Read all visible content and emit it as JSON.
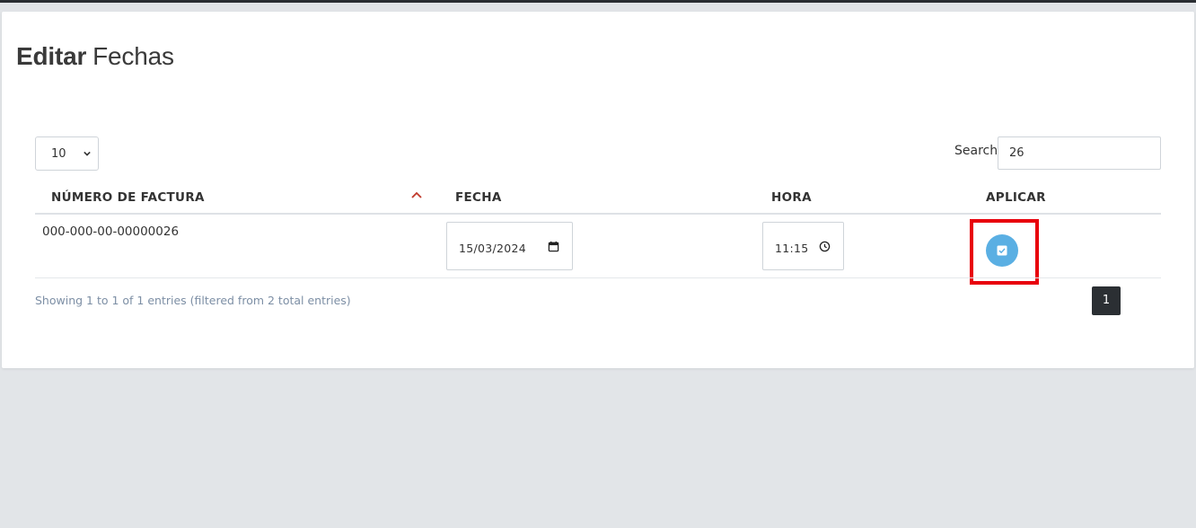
{
  "page": {
    "title_bold": "Editar",
    "title_rest": "Fechas"
  },
  "table_controls": {
    "page_length": "10",
    "search_label": "Search:",
    "search_value": "26"
  },
  "table": {
    "columns": [
      "NÚMERO DE FACTURA",
      "FECHA",
      "HORA",
      "APLICAR"
    ],
    "sort_column": "NÚMERO DE FACTURA",
    "sort_direction": "ascending",
    "rows": [
      {
        "numero": "000-000-00-00000026",
        "fecha": "15/03/2024",
        "hora": "11:15"
      }
    ]
  },
  "footer": {
    "info": "Showing 1 to 1 of 1 entries (filtered from 2 total entries)",
    "current_page": "1"
  },
  "colors": {
    "apply_button": "#5aafe3",
    "highlight": "#e8000b",
    "sort_icon": "#c0392b",
    "page_active": "#2b2f33"
  },
  "icons": {
    "sort": "chevron-up-icon",
    "date": "calendar-icon",
    "time": "clock-icon",
    "apply": "check-square-icon",
    "select": "chevron-down-icon"
  }
}
